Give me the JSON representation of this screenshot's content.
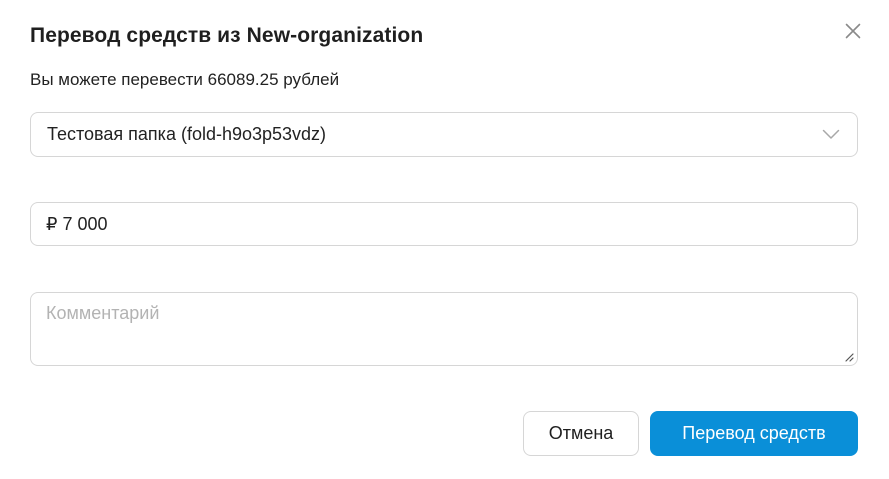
{
  "dialog": {
    "title": "Перевод средств из New-organization",
    "subtitle": "Вы можете перевести 66089.25 рублей",
    "close_icon": "close-icon"
  },
  "form": {
    "folder_select": {
      "selected_value": "Тестовая папка (fold-h9o3p53vdz)",
      "icon": "chevron-down-icon"
    },
    "amount": {
      "value": "₽ 7 000"
    },
    "comment": {
      "placeholder": "Комментарий",
      "value": ""
    }
  },
  "actions": {
    "cancel_label": "Отмена",
    "submit_label": "Перевод средств"
  },
  "colors": {
    "primary": "#0a8fd8",
    "border": "#d6d6d6",
    "placeholder": "#b3b3b3"
  }
}
